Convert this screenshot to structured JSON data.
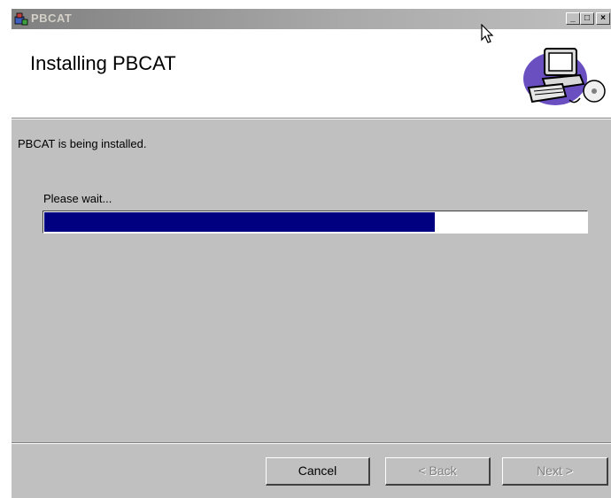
{
  "window": {
    "title": "PBCAT",
    "controls": {
      "minimize": "_",
      "maximize": "□",
      "close": "×"
    }
  },
  "header": {
    "title": "Installing PBCAT",
    "art_icon": "computer-with-cd-icon"
  },
  "main": {
    "status_text": "PBCAT is being installed.",
    "wait_text": "Please wait...",
    "progress_fraction": 0.72
  },
  "buttons": {
    "cancel": "Cancel",
    "back": "< Back",
    "next": "Next >"
  },
  "colors": {
    "progress": "#000080",
    "dialog_bg": "#c0c0c0"
  }
}
